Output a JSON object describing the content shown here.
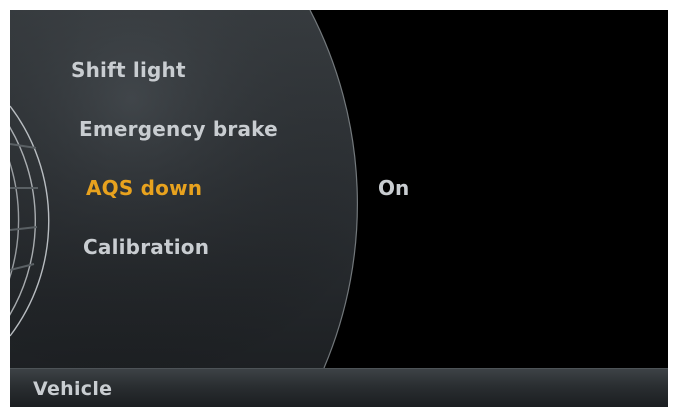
{
  "menu": {
    "items": [
      {
        "label": "Shift light",
        "selected": false
      },
      {
        "label": "Emergency brake",
        "selected": false
      },
      {
        "label": "AQS down",
        "selected": true
      },
      {
        "label": "Calibration",
        "selected": false
      }
    ],
    "selected_value": "On"
  },
  "footer": {
    "title": "Vehicle"
  },
  "colors": {
    "background": "#000000",
    "menu_text": "#c9cdd1",
    "highlight": "#e8a21e",
    "footer_bar": "#2a2e31"
  }
}
